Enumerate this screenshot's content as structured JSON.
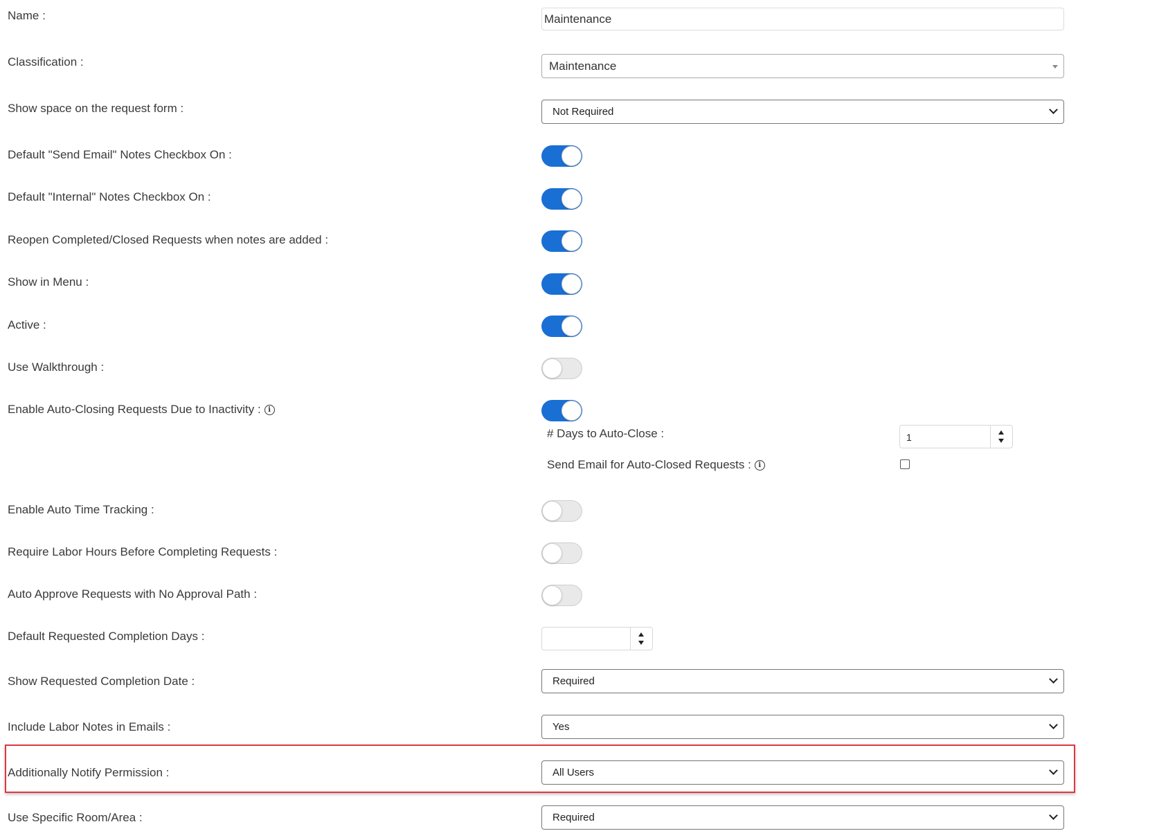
{
  "fields": {
    "name": {
      "label": "Name :",
      "value": "Maintenance"
    },
    "classification": {
      "label": "Classification :",
      "value": "Maintenance"
    },
    "show_space": {
      "label": "Show space on the request form :",
      "value": "Not Required"
    },
    "send_email_default": {
      "label": "Default \"Send Email\" Notes Checkbox On :",
      "on": true
    },
    "internal_default": {
      "label": "Default \"Internal\" Notes Checkbox On :",
      "on": true
    },
    "reopen": {
      "label": "Reopen Completed/Closed Requests when notes are added :",
      "on": true
    },
    "show_in_menu": {
      "label": "Show in Menu :",
      "on": true
    },
    "active": {
      "label": "Active :",
      "on": true
    },
    "walkthrough": {
      "label": "Use Walkthrough :",
      "on": false
    },
    "auto_close": {
      "label": "Enable Auto-Closing Requests Due to Inactivity :",
      "on": true,
      "days_label": "# Days to Auto-Close :",
      "days_value": "1",
      "email_label": "Send Email for Auto-Closed Requests :",
      "email_checked": false
    },
    "auto_time": {
      "label": "Enable Auto Time Tracking :",
      "on": false
    },
    "labor_hours": {
      "label": "Require Labor Hours Before Completing Requests :",
      "on": false
    },
    "auto_approve": {
      "label": "Auto Approve Requests with No Approval Path :",
      "on": false
    },
    "completion_days": {
      "label": "Default Requested Completion Days :",
      "value": ""
    },
    "completion_date": {
      "label": "Show Requested Completion Date :",
      "value": "Required"
    },
    "labor_notes": {
      "label": "Include Labor Notes in Emails :",
      "value": "Yes"
    },
    "notify_permission": {
      "label": "Additionally Notify Permission :",
      "value": "All Users"
    },
    "room_area": {
      "label": "Use Specific Room/Area :",
      "value": "Required"
    }
  },
  "icons": {
    "info": "info-circle-icon"
  },
  "colors": {
    "toggle_on": "#1a6fd4",
    "highlight": "#e0363f"
  }
}
